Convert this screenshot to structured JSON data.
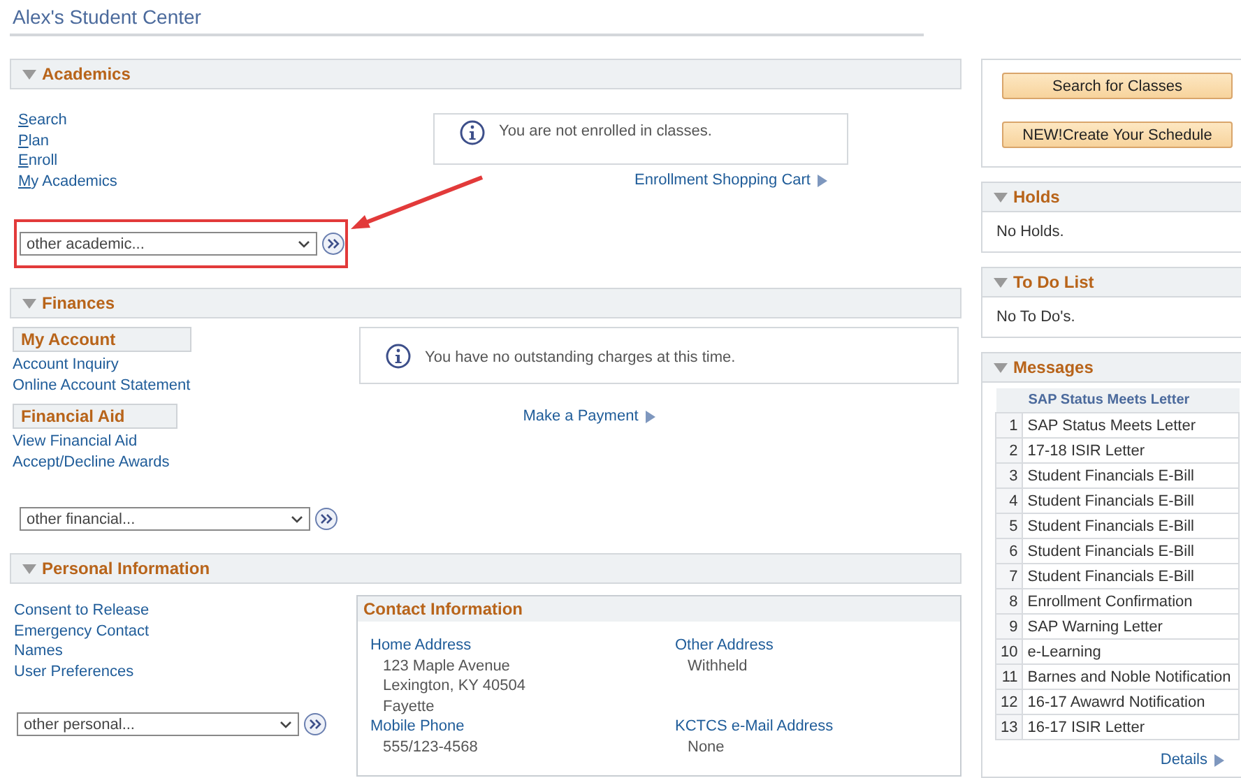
{
  "page_title": "Alex's Student Center",
  "academics": {
    "title": "Academics",
    "links": [
      "Search",
      "Plan",
      "Enroll",
      "My Academics"
    ],
    "notice": "You are not enrolled in classes.",
    "cart_link": "Enrollment Shopping Cart",
    "dropdown": "other academic..."
  },
  "finances": {
    "title": "Finances",
    "groups": [
      {
        "title": "My Account",
        "links": [
          "Account Inquiry",
          "Online Account Statement"
        ]
      },
      {
        "title": "Financial Aid",
        "links": [
          "View Financial Aid",
          "Accept/Decline Awards"
        ]
      }
    ],
    "notice": "You have no outstanding charges at this time.",
    "payment_link": "Make a Payment",
    "dropdown": "other financial..."
  },
  "personal": {
    "title": "Personal Information",
    "links": [
      "Consent to Release",
      "Emergency Contact",
      "Names",
      "User Preferences"
    ],
    "dropdown": "other personal...",
    "contact": {
      "title": "Contact Information",
      "fields": [
        {
          "label": "Home Address",
          "lines": [
            "123 Maple Avenue",
            "Lexington, KY 40504",
            "Fayette"
          ]
        },
        {
          "label": "Other Address",
          "lines": [
            "Withheld"
          ]
        },
        {
          "label": "Mobile Phone",
          "lines": [
            "555/123-4568"
          ]
        },
        {
          "label": "KCTCS e-Mail Address",
          "lines": [
            "None"
          ]
        }
      ]
    }
  },
  "side_buttons": [
    "Search for Classes",
    "NEW!Create Your Schedule"
  ],
  "holds": {
    "title": "Holds",
    "text": "No Holds."
  },
  "todo": {
    "title": "To Do List",
    "text": "No To Do's."
  },
  "messages": {
    "title": "Messages",
    "column_header": "SAP Status Meets Letter",
    "rows": [
      {
        "num": "1",
        "text": "SAP Status Meets Letter"
      },
      {
        "num": "2",
        "text": "17-18 ISIR Letter"
      },
      {
        "num": "3",
        "text": "Student Financials E-Bill"
      },
      {
        "num": "4",
        "text": "Student Financials E-Bill"
      },
      {
        "num": "5",
        "text": "Student Financials E-Bill"
      },
      {
        "num": "6",
        "text": "Student Financials E-Bill"
      },
      {
        "num": "7",
        "text": "Student Financials E-Bill"
      },
      {
        "num": "8",
        "text": "Enrollment Confirmation"
      },
      {
        "num": "9",
        "text": "SAP Warning Letter"
      },
      {
        "num": "10",
        "text": "e-Learning"
      },
      {
        "num": "11",
        "text": "Barnes and Noble Notification"
      },
      {
        "num": "12",
        "text": "16-17 Awawrd Notification"
      },
      {
        "num": "13",
        "text": "16-17 ISIR Letter"
      }
    ],
    "details_link": "Details"
  }
}
